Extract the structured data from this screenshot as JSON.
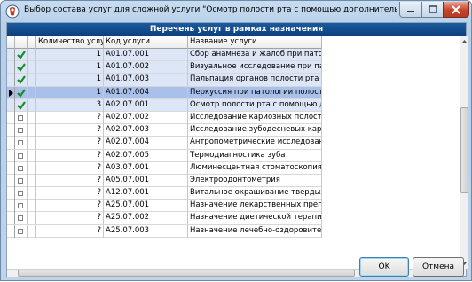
{
  "window": {
    "title": "Выбор состава услуг для сложной услуги \"Осмотр полости рта с помощью дополнительных инстр..."
  },
  "grid": {
    "caption": "Перечень услуг в рамках назначения",
    "columns": {
      "quantity": "Количество услуг",
      "code": "Код услуги",
      "name": "Название услуги"
    },
    "rows": [
      {
        "checked": true,
        "current": false,
        "qty": "1",
        "code": "A01.07.001",
        "name": "Сбор анамнеза и жалоб при патологи"
      },
      {
        "checked": true,
        "current": false,
        "qty": "1",
        "code": "A01.07.002",
        "name": "Визуальное исследование при патологи"
      },
      {
        "checked": true,
        "current": false,
        "qty": "1",
        "code": "A01.07.003",
        "name": "Пальпация органов полости рта"
      },
      {
        "checked": true,
        "current": true,
        "qty": "1",
        "code": "A01.07.004",
        "name": "Перкуссия при патологии полости рта"
      },
      {
        "checked": true,
        "current": false,
        "qty": "3",
        "code": "A02.07.001",
        "name": "Осмотр полости рта с помощью дополни"
      },
      {
        "checked": false,
        "current": false,
        "qty": "?",
        "code": "A02.07.002",
        "name": "Исследование кариозных полостей с и"
      },
      {
        "checked": false,
        "current": false,
        "qty": "?",
        "code": "A02.07.003",
        "name": "Исследование зубодесневых карманов"
      },
      {
        "checked": false,
        "current": false,
        "qty": "?",
        "code": "A02.07.004",
        "name": "Антропометрические исследования"
      },
      {
        "checked": false,
        "current": false,
        "qty": "?",
        "code": "A02.07.005",
        "name": "Термодиагностика зуба"
      },
      {
        "checked": false,
        "current": false,
        "qty": "?",
        "code": "A03.07.001",
        "name": "Люминесцентная стоматоскопия"
      },
      {
        "checked": false,
        "current": false,
        "qty": "?",
        "code": "A05.07.001",
        "name": "Электроодонтометрия"
      },
      {
        "checked": false,
        "current": false,
        "qty": "?",
        "code": "A12.07.001",
        "name": "Витальное окрашивание твердых ткан"
      },
      {
        "checked": false,
        "current": false,
        "qty": "?",
        "code": "A25.07.001",
        "name": "Назначение лекарственных препарат"
      },
      {
        "checked": false,
        "current": false,
        "qty": "?",
        "code": "A25.07.002",
        "name": "Назначение диетической терапии при"
      },
      {
        "checked": false,
        "current": false,
        "qty": "?",
        "code": "A25.07.003",
        "name": "Назначение лечебно-оздоровительног"
      }
    ]
  },
  "buttons": {
    "ok": "OK",
    "cancel": "Отмена"
  },
  "icons": {
    "app": "app-icon",
    "check": "green-check-icon",
    "pointer": "row-pointer-icon"
  },
  "colors": {
    "caption_bg": "#0d3f7c",
    "selected_row": "#dde6f6",
    "current_row": "#a9c1ea",
    "check_mark": "#1d8a2a"
  }
}
